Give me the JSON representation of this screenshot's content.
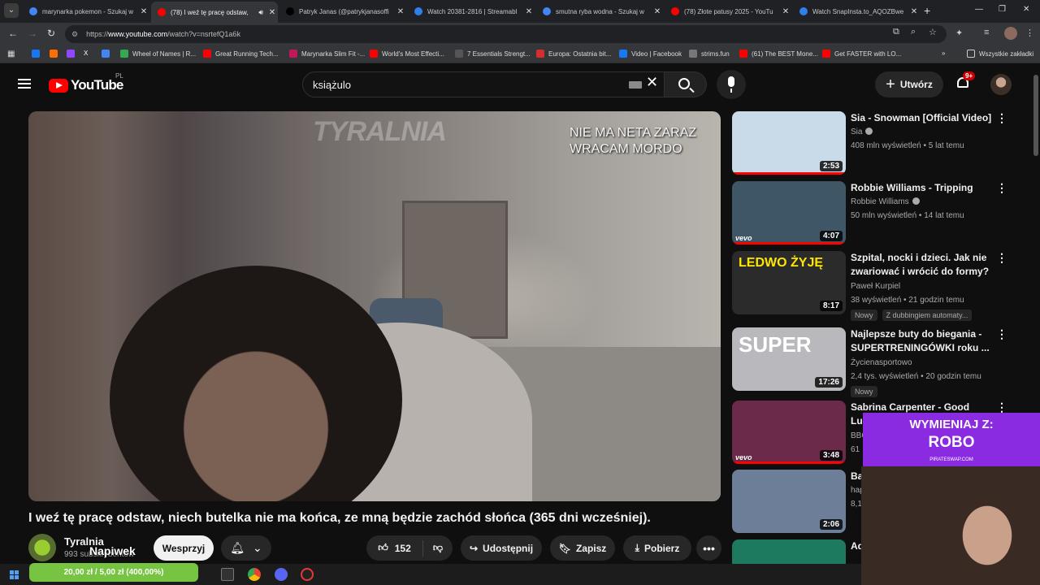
{
  "browser": {
    "tabs": [
      {
        "title": "marynarka pokemon - Szukaj w",
        "favicon_color": "#4285f4",
        "active": false
      },
      {
        "title": "(78) I weź tę pracę odstaw,",
        "favicon_color": "#ff0000",
        "active": true
      },
      {
        "title": "Patryk Janas (@patrykjanasoffi",
        "favicon_color": "#000000",
        "active": false
      },
      {
        "title": "Watch 20381-2816 | Streamabl",
        "favicon_color": "#2f80ed",
        "active": false
      },
      {
        "title": "smutna ryba wodna - Szukaj w",
        "favicon_color": "#4285f4",
        "active": false
      },
      {
        "title": "(78) Złote patusy 2025 - YouTu",
        "favicon_color": "#ff0000",
        "active": false
      },
      {
        "title": "Watch SnapInsta.to_AQOZBwe",
        "favicon_color": "#2f80ed",
        "active": false
      }
    ],
    "url_prefix": "https://",
    "url_domain": "www.youtube.com",
    "url_path": "/watch?v=nsrtefQ1a6k",
    "bookmarks": [
      {
        "label": "Wheel of Names | R...",
        "color": "#34a853"
      },
      {
        "label": "Great Running Tech...",
        "color": "#ff0000"
      },
      {
        "label": "Marynarka Slim Fit -...",
        "color": "#c2185b"
      },
      {
        "label": "World's Most Effecti...",
        "color": "#ff0000"
      },
      {
        "label": "7 Essentials Strengt...",
        "color": "#555555"
      },
      {
        "label": "Europa: Ostatnia bit...",
        "color": "#d32f2f"
      },
      {
        "label": "Video | Facebook",
        "color": "#1877f2"
      },
      {
        "label": "strims.fun",
        "color": "#777777"
      },
      {
        "label": "(61) The BEST Mone...",
        "color": "#ff0000"
      },
      {
        "label": "Get FASTER with LO...",
        "color": "#ff0000"
      }
    ],
    "all_bookmarks": "Wszystkie zakładki"
  },
  "youtube": {
    "logo_text": "YouTube",
    "region": "PL",
    "search_value": "książulo",
    "create_label": "Utwórz",
    "notifications_badge": "9+",
    "video": {
      "title": "I weź tę pracę odstaw, niech butelka nie ma końca, ze mną będzie zachód słońca (365 dni wcześniej).",
      "watermark": "TYRALNIA",
      "overlay_text": "NIE MA NETA ZARAZ\nWRACAM MORDO",
      "channel_name": "Tyralnia",
      "channel_subs": "993 subskrybentów",
      "support_label": "Wesprzyj",
      "like_count": "152",
      "share_label": "Udostępnij",
      "save_label": "Zapisz",
      "download_label": "Pobierz"
    },
    "recommendations": [
      {
        "title": "Sia - Snowman [Official Video]",
        "channel": "Sia",
        "verified": true,
        "meta": "408 mln wyświetleń • 5 lat temu",
        "duration": "2:53",
        "thumb_color": "#c9dbe8",
        "tags": [],
        "watched_fraction": 1.0,
        "vevo": false
      },
      {
        "title": "Robbie Williams - Tripping",
        "channel": "Robbie Williams",
        "verified": true,
        "meta": "50 mln wyświetleń • 14 lat temu",
        "duration": "4:07",
        "thumb_color": "#3e5666",
        "tags": [],
        "watched_fraction": 1.0,
        "vevo": true
      },
      {
        "title": "Szpital, nocki i dzieci. Jak nie zwariować i wrócić do formy?",
        "channel": "Paweł Kurpiel",
        "verified": false,
        "meta": "38 wyświetleń • 21 godzin temu",
        "duration": "8:17",
        "thumb_color": "#2b2b2b",
        "tags": [
          "Nowy",
          "Z dubbingiem automaty..."
        ],
        "watched_fraction": 0,
        "vevo": false,
        "thumb_text": "LEDWO ŻYJĘ"
      },
      {
        "title": "Najlepsze buty do biegania - SUPERTRENINGÓWKI roku ...",
        "channel": "Życienasportowo",
        "verified": false,
        "meta": "2,4 tys. wyświetleń • 20 godzin temu",
        "duration": "17:26",
        "thumb_color": "#b9b9bd",
        "tags": [
          "Nowy"
        ],
        "watched_fraction": 0,
        "vevo": false,
        "thumb_text": "SUPER"
      },
      {
        "title": "Sabrina Carpenter - Good Luck, Ba...",
        "channel": "BBC",
        "verified": false,
        "meta": "61",
        "duration": "3:48",
        "thumb_color": "#6b2a4a",
        "tags": [],
        "watched_fraction": 1.0,
        "vevo": true
      },
      {
        "title": "Ba... Ha...",
        "channel": "hap",
        "verified": false,
        "meta": "8,1",
        "duration": "2:06",
        "thumb_color": "#6d7f98",
        "tags": [],
        "watched_fraction": 0,
        "vevo": false
      },
      {
        "title": "Ad... Vic...",
        "channel": "",
        "verified": false,
        "meta": "",
        "duration": "",
        "thumb_color": "#1e7a5e",
        "tags": [],
        "watched_fraction": 0,
        "vevo": false
      }
    ]
  },
  "stream_overlay": {
    "tip_label": "Napiwek",
    "promo_line1": "WYMIENIAJ Z:",
    "promo_line2": "ROBO",
    "promo_line3": "PIRATESWAP.COM",
    "donation_text": "20,00 zł / 5,00 zł (400,00%)",
    "donation_color": "#76c442"
  }
}
